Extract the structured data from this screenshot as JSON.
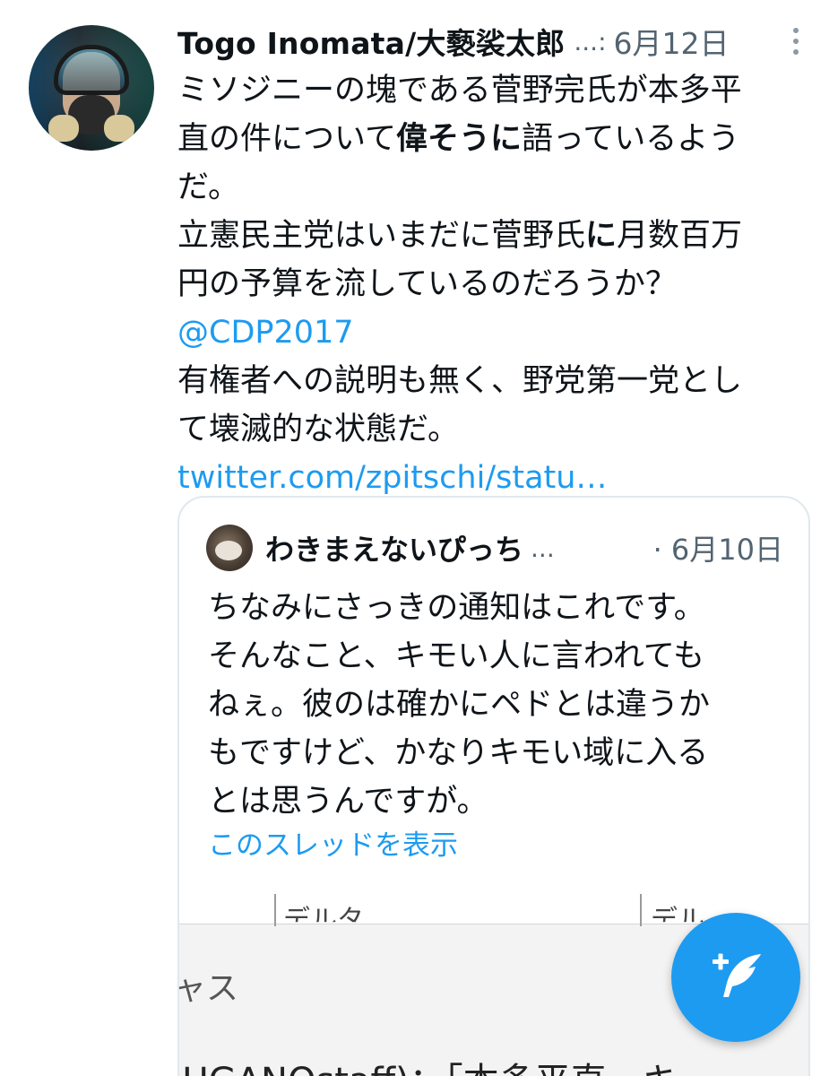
{
  "tweet": {
    "author_name": "Togo Inomata/大褻裟太郎",
    "name_truncation": "...:",
    "date": "6月12日",
    "lines": [
      "ミソジニーの塊である菅野完氏が本多平",
      "直の件について",
      "偉そうに",
      "語っているよう",
      "だ。",
      "立憲民主党はいまだに菅野氏",
      "に",
      "月数百万",
      "円の予算を流しているのだろうか？",
      "有権者への説明も無く、野党第一党とし",
      "て壊滅的な状態だ。"
    ],
    "mention": "@CDP2017",
    "link": "twitter.com/zpitschi/statu…"
  },
  "quote": {
    "author_name": "わきまえないぴっち",
    "name_truncation": "...",
    "separator": "·",
    "date": "6月10日",
    "lines": [
      "ちなみにさっきの通知はこれです。",
      "そんなこと、キモい人に言われても",
      "ねぇ。彼のは確かにペドとは違うか",
      "もですけど、かなりキモい域に入る",
      "とは思うんですが。"
    ],
    "show_thread": "このスレッドを表示",
    "image": {
      "column_a": "デルタ",
      "column_b": "デル",
      "row_label": "ャス",
      "row_content": "SUGANOstaff)：「本多平直、キ"
    }
  },
  "fab": {
    "icon": "compose-quill-icon"
  },
  "colors": {
    "accent": "#1d9bf0",
    "secondary_text": "#536471",
    "border": "#e1e8ed"
  }
}
